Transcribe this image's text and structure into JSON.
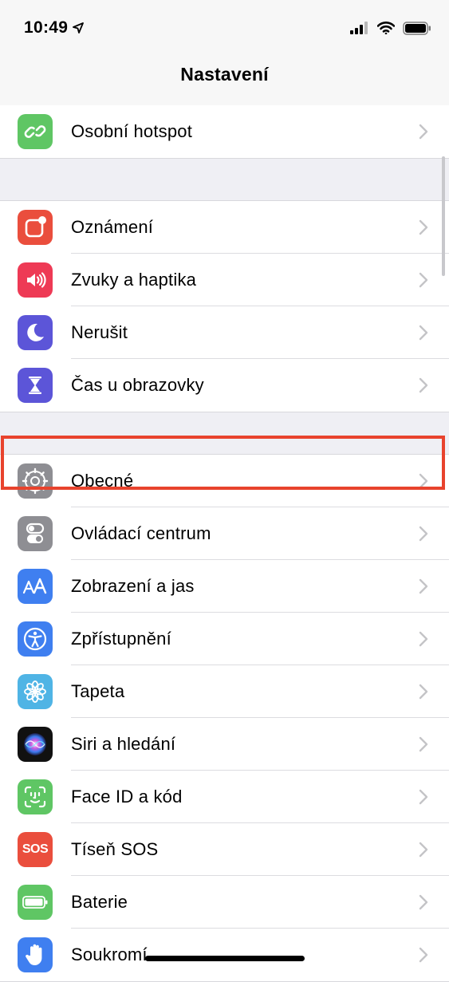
{
  "status": {
    "time": "10:49"
  },
  "nav": {
    "title": "Nastavení"
  },
  "groups": [
    {
      "items": [
        {
          "label": "Osobní hotspot"
        }
      ]
    },
    {
      "items": [
        {
          "label": "Oznámení"
        },
        {
          "label": "Zvuky a haptika"
        },
        {
          "label": "Nerušit"
        },
        {
          "label": "Čas u obrazovky"
        }
      ]
    },
    {
      "items": [
        {
          "label": "Obecné"
        },
        {
          "label": "Ovládací centrum"
        },
        {
          "label": "Zobrazení a jas"
        },
        {
          "label": "Zpřístupnění"
        },
        {
          "label": "Tapeta"
        },
        {
          "label": "Siri a hledání"
        },
        {
          "label": "Face ID a kód"
        },
        {
          "label": "Tíseň SOS"
        },
        {
          "label": "Baterie"
        },
        {
          "label": "Soukromí"
        }
      ]
    }
  ],
  "icons": {
    "hotspot": {
      "name": "chain-link-icon",
      "color": "#5fc664"
    },
    "notifications": {
      "name": "notification-badge-icon",
      "color": "#ea4e3d"
    },
    "sounds": {
      "name": "speaker-icon",
      "color": "#ee3a55"
    },
    "dnd": {
      "name": "moon-icon",
      "color": "#5c55d8"
    },
    "screentime": {
      "name": "hourglass-icon",
      "color": "#5c55d8"
    },
    "general": {
      "name": "gear-icon",
      "color": "#8e8e93"
    },
    "control": {
      "name": "toggles-icon",
      "color": "#8e8e93"
    },
    "display": {
      "name": "text-size-icon",
      "color": "#3f7ff0"
    },
    "access": {
      "name": "accessibility-icon",
      "color": "#3f7ff0"
    },
    "wallpaper": {
      "name": "flower-icon",
      "color": "#4fb4e5"
    },
    "siri": {
      "name": "siri-icon",
      "color": "#111111"
    },
    "faceid": {
      "name": "face-id-icon",
      "color": "#5fc664"
    },
    "sos": {
      "name": "sos-icon",
      "color": "#ea4e3d",
      "text": "SOS"
    },
    "battery": {
      "name": "battery-icon",
      "color": "#5fc664"
    },
    "privacy": {
      "name": "hand-icon",
      "color": "#3f7ff0"
    }
  },
  "highlight_color": "#e8432d"
}
